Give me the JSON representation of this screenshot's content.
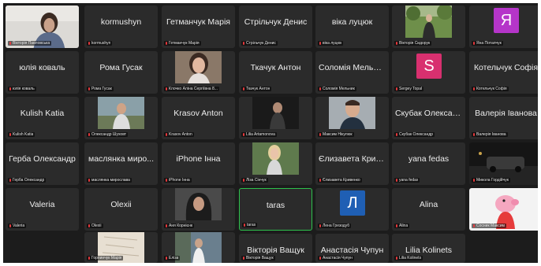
{
  "participants": [
    {
      "name": "Вікторія Павловська",
      "label": "Вікторія Павловська",
      "kind": "video",
      "video": "teacher-video"
    },
    {
      "name": "kormushyn",
      "label": "kormushyn",
      "kind": "name"
    },
    {
      "name": "Гетманчук Марія",
      "label": "Гетманчук Марія",
      "kind": "name"
    },
    {
      "name": "Стрільчук Денис",
      "label": "Стрільчук Денис",
      "kind": "name"
    },
    {
      "name": "віка луцюк",
      "label": "віка луцюк",
      "kind": "name"
    },
    {
      "name": "Вікторія Сидорук",
      "label": "Вікторія Сидорук",
      "kind": "photo",
      "video": "park-photo"
    },
    {
      "name": "Яна Потапчук",
      "label": "Яна Потапчук",
      "kind": "avatar",
      "initial": "Я",
      "color": "#b535c9"
    },
    {
      "name": "юлія коваль",
      "label": "юлія коваль",
      "kind": "name"
    },
    {
      "name": "Рома Гусак",
      "label": "Рома Гусак",
      "kind": "name"
    },
    {
      "name": "Клочко Аліна Сергіївна",
      "label": "Клочко Аліна Сергіївна 8...",
      "kind": "photo",
      "video": "portrait-photo"
    },
    {
      "name": "Ткачук Антон",
      "label": "Ткачук Антон",
      "kind": "name"
    },
    {
      "name": "Соломія Мельник",
      "label": "Соломія Мельник",
      "kind": "name"
    },
    {
      "name": "Sergey Topal",
      "label": "Sergey Topal",
      "kind": "avatar",
      "initial": "S",
      "color": "#d8306f"
    },
    {
      "name": "Котельчук Софія",
      "label": "Котельчук Софія",
      "kind": "name"
    },
    {
      "name": "Kulish Katia",
      "label": "Kulish Katia",
      "kind": "name"
    },
    {
      "name": "Олександр Шуховт",
      "label": "Олександр Шуховт",
      "kind": "photo",
      "video": "outdoor-photo"
    },
    {
      "name": "Krasov Anton",
      "label": "Krasov Anton",
      "kind": "name"
    },
    {
      "name": "Lilia Artamonova",
      "label": "Lilia Artamonova",
      "kind": "photo",
      "video": "dark-photo"
    },
    {
      "name": "Максим Нікулюк",
      "label": "Максим Нікулюк",
      "kind": "photo",
      "video": "selfie-photo"
    },
    {
      "name": "Скубак Олексан...",
      "label": "Скубак Олександр",
      "kind": "name"
    },
    {
      "name": "Валерія Іванова",
      "label": "Валерія Іванова",
      "kind": "name"
    },
    {
      "name": "Герба Олександр",
      "label": "Герба Олександр",
      "kind": "name"
    },
    {
      "name": "маслянка миро...",
      "label": "маслянка мирослава",
      "kind": "name"
    },
    {
      "name": "iPhone Інна",
      "label": "iPhone Інна",
      "kind": "name"
    },
    {
      "name": "Ліза Сінчук",
      "label": "Ліза Сінчук",
      "kind": "photo",
      "video": "blonde-photo"
    },
    {
      "name": "Єлизавета Крив...",
      "label": "Єлизавета Кривенко",
      "kind": "name"
    },
    {
      "name": "yana fedas",
      "label": "yana fedas",
      "kind": "name"
    },
    {
      "name": "Микола Гордійчук",
      "label": "Микола Гордійчук",
      "kind": "full",
      "video": "night-street"
    },
    {
      "name": "Valeria",
      "label": "Valeria",
      "kind": "name"
    },
    {
      "name": "Olexii",
      "label": "Olexii",
      "kind": "name"
    },
    {
      "name": "Аня Корнієнк",
      "label": "Аня Корнієнк",
      "kind": "photo",
      "video": "hood-photo"
    },
    {
      "name": "taras",
      "label": "taras",
      "kind": "name",
      "active": true
    },
    {
      "name": "Лена Грезодуб",
      "label": "Лена Грезодуб",
      "kind": "avatar",
      "initial": "Л",
      "color": "#1f5fb4"
    },
    {
      "name": "Alina",
      "label": "Alina",
      "kind": "name"
    },
    {
      "name": "Сосник Максим",
      "label": "Сосник Максим",
      "kind": "full",
      "video": "peppa-pig"
    },
    {
      "name": "Горпинчук Марія",
      "label": "Горпинчук Марія",
      "kind": "photo",
      "video": "paper-photo"
    },
    {
      "name": "Еліза",
      "label": "Еліза",
      "kind": "photo",
      "video": "street-photo"
    },
    {
      "name": "Вікторія Ващук",
      "label": "Вікторія Ващук",
      "kind": "name"
    },
    {
      "name": "Анастасія Чупун",
      "label": "Анастасія Чупун",
      "kind": "name"
    },
    {
      "name": "Lilia Kolinets",
      "label": "Lilia Kolinets",
      "kind": "name"
    }
  ]
}
